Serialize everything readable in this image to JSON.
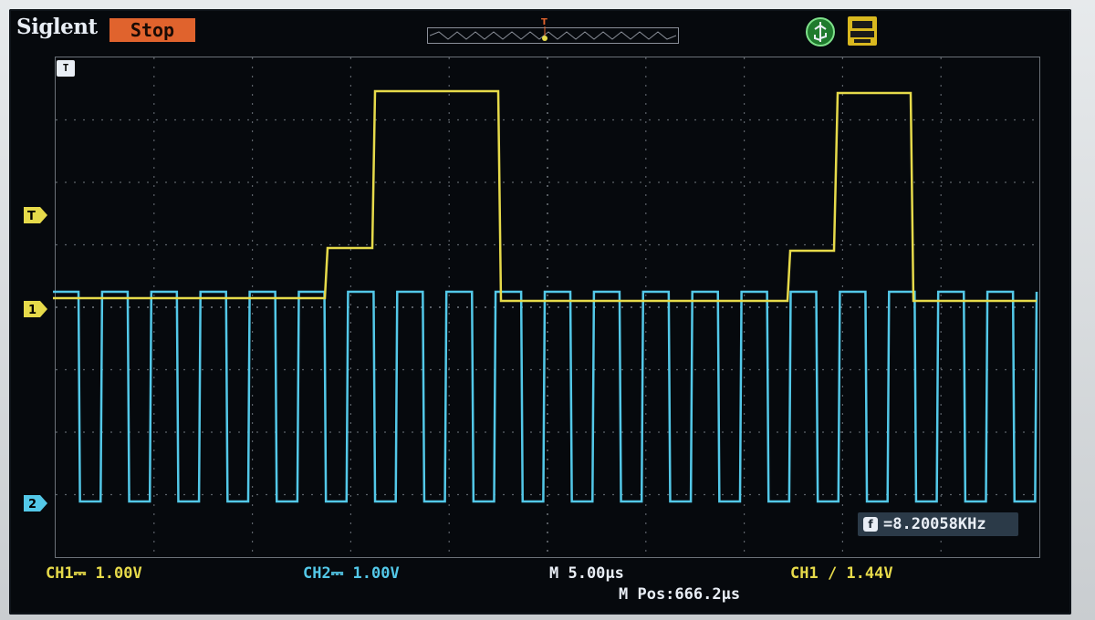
{
  "brand": "Siglent",
  "run_state": "Stop",
  "trigger_marker_symbol": "T",
  "channel_markers": {
    "trigger_level": "T",
    "ch1": "1",
    "ch2": "2"
  },
  "icons": {
    "usb": "usb-icon",
    "print": "print-icon",
    "frequency": "frequency-counter-icon",
    "trigger_position": "trigger-position-icon"
  },
  "readouts": {
    "ch1": "CH1⎓ 1.00V",
    "ch2": "CH2⎓ 1.00V",
    "timebase": "M 5.00μs",
    "horizontal_position": "M Pos:666.2μs",
    "trigger": "CH1 ∕ 1.44V",
    "frequency_icon_glyph": "f",
    "frequency": "=8.20058KHz"
  },
  "colors": {
    "ch1": "#e6da4a",
    "ch2": "#53c8e8",
    "run_state_bg": "#e0632d",
    "grid": "#6b7178"
  }
}
